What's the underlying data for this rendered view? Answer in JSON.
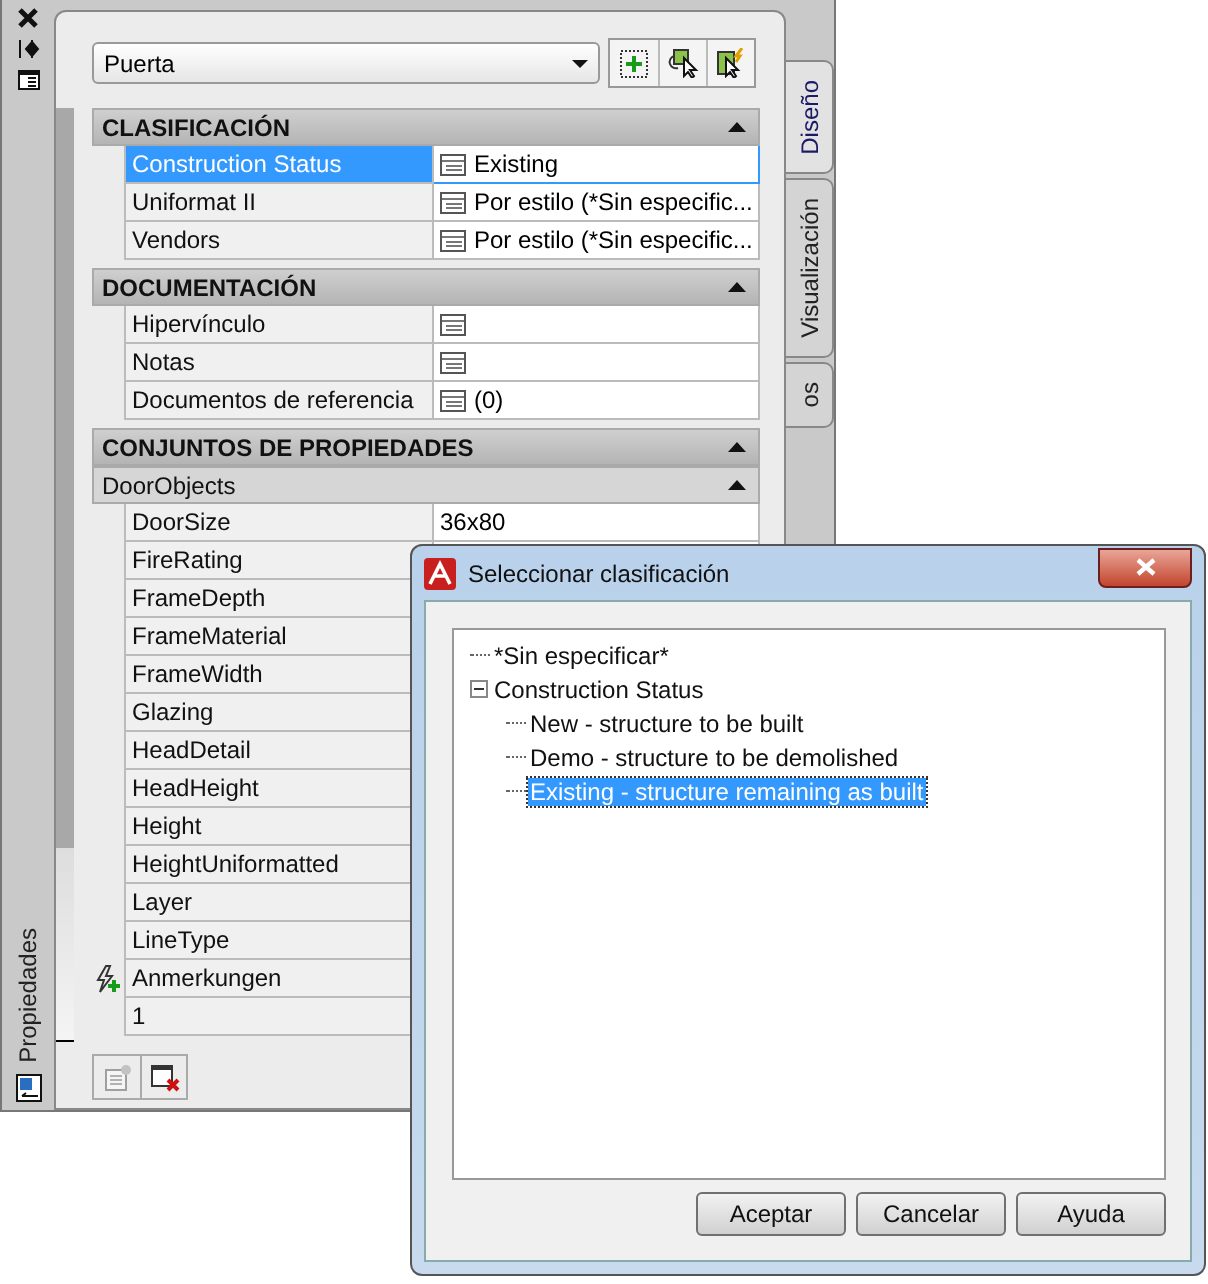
{
  "palette": {
    "title": "Propiedades",
    "object_type": "Puerta",
    "tabs": [
      {
        "label": "Diseño",
        "selected": true
      },
      {
        "label": "Visualización",
        "selected": false
      },
      {
        "label": "os",
        "selected": false
      }
    ],
    "sections": [
      {
        "title": "CLASIFICACIÓN",
        "expanded": true,
        "rows": [
          {
            "label": "Construction Status",
            "value": "Existing",
            "kind": "list",
            "selected": true
          },
          {
            "label": "Uniformat II",
            "value": "Por estilo (*Sin especific...",
            "kind": "list",
            "selected": false
          },
          {
            "label": "Vendors",
            "value": "Por estilo (*Sin especific...",
            "kind": "list",
            "selected": false
          }
        ]
      },
      {
        "title": "DOCUMENTACIÓN",
        "expanded": true,
        "rows": [
          {
            "label": "Hipervínculo",
            "kind": "list",
            "selected": false
          },
          {
            "label": "Notas",
            "kind": "list",
            "selected": false
          },
          {
            "label": "Documentos de referencia",
            "value": "(0)",
            "kind": "list",
            "selected": false
          }
        ]
      },
      {
        "title": "CONJUNTOS DE PROPIEDADES",
        "expanded": true,
        "groups": [
          {
            "title": "DoorObjects",
            "expanded": true,
            "rows": [
              {
                "label": "DoorSize",
                "value": "36x80",
                "kind": "plain",
                "selected": false
              },
              {
                "label": "FireRating",
                "kind": "plain",
                "selected": false
              },
              {
                "label": "FrameDepth",
                "kind": "plain",
                "selected": false
              },
              {
                "label": "FrameMaterial",
                "kind": "plain",
                "selected": false
              },
              {
                "label": "FrameWidth",
                "kind": "plain",
                "selected": false
              },
              {
                "label": "Glazing",
                "kind": "plain",
                "selected": false
              },
              {
                "label": "HeadDetail",
                "kind": "plain",
                "selected": false
              },
              {
                "label": "HeadHeight",
                "kind": "plain",
                "selected": false
              },
              {
                "label": "Height",
                "kind": "plain",
                "selected": false
              },
              {
                "label": "HeightUniformatted",
                "kind": "plain",
                "selected": false
              },
              {
                "label": "Layer",
                "kind": "plain",
                "selected": false
              },
              {
                "label": "LineType",
                "kind": "plain",
                "selected": false
              },
              {
                "label": "Anmerkungen",
                "kind": "added",
                "selected": false
              },
              {
                "label": "1",
                "kind": "plain",
                "selected": false
              }
            ]
          }
        ]
      }
    ]
  },
  "dialog": {
    "title": "Seleccionar clasificación",
    "tree": [
      {
        "label": "*Sin especificar*",
        "selected": false
      },
      {
        "label": "Construction Status",
        "selected": false,
        "expanded": true,
        "children": [
          {
            "label": "New - structure to be built",
            "selected": false
          },
          {
            "label": "Demo - structure to be demolished",
            "selected": false
          },
          {
            "label": "Existing - structure remaining as built",
            "selected": true
          }
        ]
      }
    ],
    "buttons": [
      "Aceptar",
      "Cancelar",
      "Ayuda"
    ]
  }
}
